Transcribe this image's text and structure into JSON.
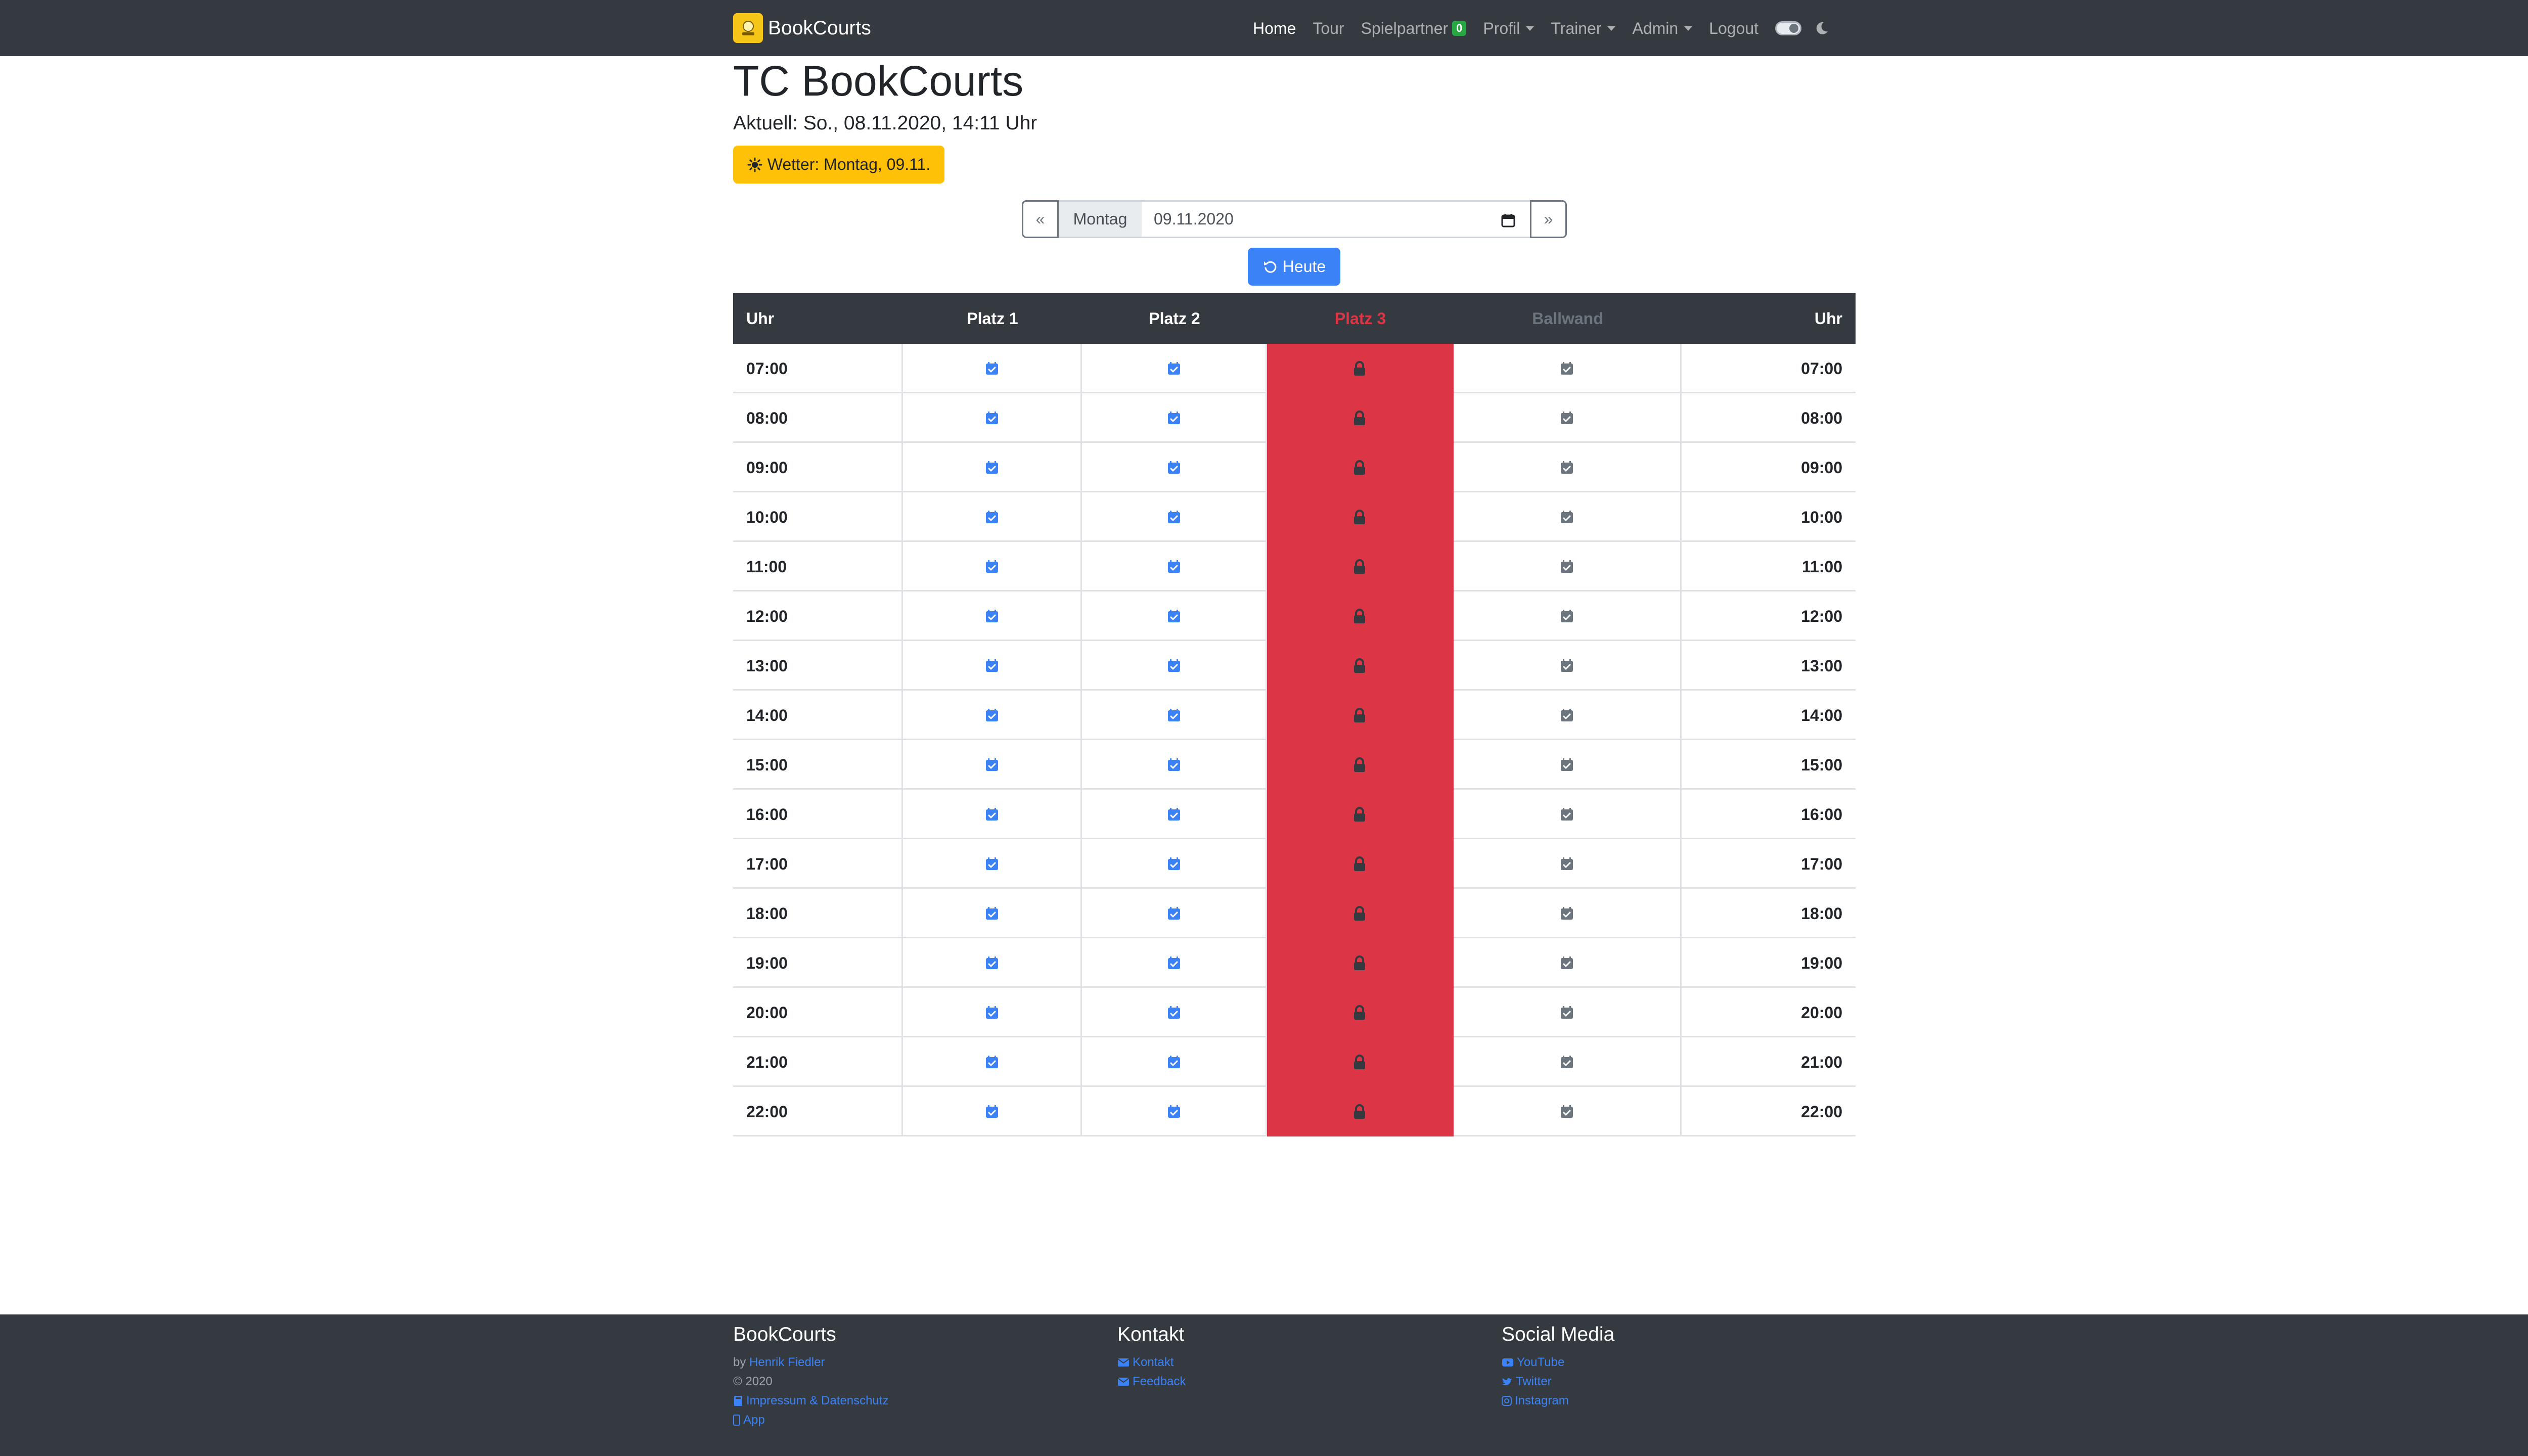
{
  "app": {
    "brand": "BookCourts"
  },
  "nav": {
    "home": "Home",
    "tour": "Tour",
    "spielpartner": "Spielpartner",
    "spielpartner_badge": "0",
    "profil": "Profil",
    "trainer": "Trainer",
    "admin": "Admin",
    "logout": "Logout"
  },
  "header": {
    "title": "TC BookCourts",
    "current": "Aktuell: So., 08.11.2020, 14:11 Uhr",
    "weather": "Wetter: Montag, 09.11."
  },
  "datenav": {
    "prev": "«",
    "day": "Montag",
    "date": "09.11.2020",
    "next": "»",
    "today": "Heute"
  },
  "table": {
    "columns": [
      "Uhr",
      "Platz 1",
      "Platz 2",
      "Platz 3",
      "Ballwand",
      "Uhr"
    ],
    "rows": [
      "07:00",
      "08:00",
      "09:00",
      "10:00",
      "11:00",
      "12:00",
      "13:00",
      "14:00",
      "15:00",
      "16:00",
      "17:00",
      "18:00",
      "19:00",
      "20:00",
      "21:00",
      "22:00"
    ],
    "cell_icons": {
      "platz1": "calendar-check-icon",
      "platz2": "calendar-check-icon",
      "platz3": "lock-icon",
      "ballwand": "calendar-check-icon"
    },
    "colors": {
      "available": "#3b82f6",
      "blocked_bg": "#dc3545",
      "ballwand": "#6c757d"
    }
  },
  "footer": {
    "col1": {
      "title": "BookCourts",
      "by": "by",
      "author": "Henrik Fiedler",
      "year": "© 2020",
      "imprint": "Impressum & Datenschutz",
      "app": "App"
    },
    "col2": {
      "title": "Kontakt",
      "kontakt": "Kontakt",
      "feedback": "Feedback"
    },
    "col3": {
      "title": "Social Media",
      "youtube": "YouTube",
      "twitter": "Twitter",
      "instagram": "Instagram"
    }
  }
}
